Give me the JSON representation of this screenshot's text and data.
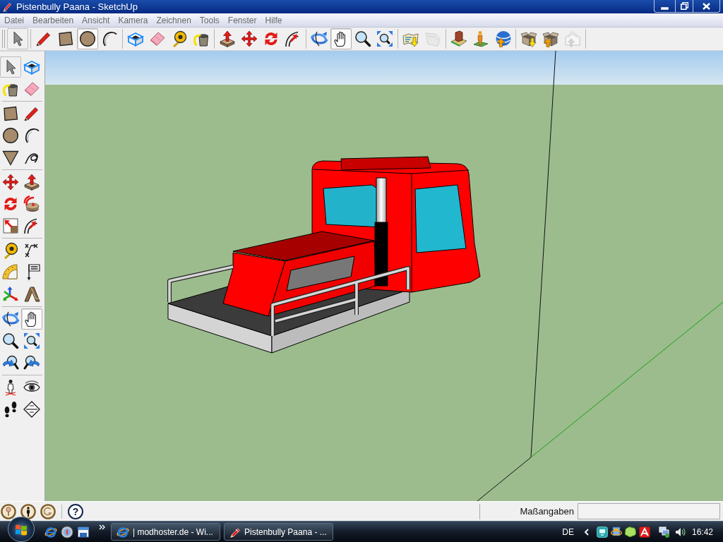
{
  "window": {
    "title": "Pistenbully Paana - SketchUp"
  },
  "menu_bar": [
    "Datei",
    "Bearbeiten",
    "Ansicht",
    "Kamera",
    "Zeichnen",
    "Tools",
    "Fenster",
    "Hilfe"
  ],
  "top_toolbar": {
    "groups": [
      [
        {
          "selected": false,
          "focused": true,
          "disabled": false
        }
      ],
      [
        {
          "selected": false,
          "focused": false,
          "disabled": false
        },
        {
          "selected": false,
          "focused": false,
          "disabled": false
        },
        {
          "selected": true,
          "focused": false,
          "disabled": false
        },
        {
          "selected": false,
          "focused": false,
          "disabled": false
        }
      ],
      [
        {
          "selected": false,
          "focused": false,
          "disabled": false
        },
        {
          "selected": false,
          "focused": false,
          "disabled": false
        },
        {
          "selected": false,
          "focused": false,
          "disabled": false
        },
        {
          "selected": false,
          "focused": false,
          "disabled": false
        }
      ],
      [
        {
          "selected": false,
          "focused": false,
          "disabled": false
        },
        {
          "selected": false,
          "focused": false,
          "disabled": false
        },
        {
          "selected": false,
          "focused": false,
          "disabled": false
        },
        {
          "selected": false,
          "focused": false,
          "disabled": false
        }
      ],
      [
        {
          "selected": false,
          "focused": false,
          "disabled": false
        },
        {
          "selected": true,
          "focused": false,
          "disabled": false
        },
        {
          "selected": false,
          "focused": false,
          "disabled": false
        },
        {
          "selected": false,
          "focused": false,
          "disabled": false
        }
      ],
      [
        {
          "selected": false,
          "focused": false,
          "disabled": false
        },
        {
          "selected": false,
          "focused": false,
          "disabled": true
        }
      ],
      [
        {
          "selected": false,
          "focused": false,
          "disabled": false
        },
        {
          "selected": false,
          "focused": false,
          "disabled": false
        },
        {
          "selected": false,
          "focused": false,
          "disabled": false
        }
      ],
      [
        {
          "selected": false,
          "focused": false,
          "disabled": false
        },
        {
          "selected": false,
          "focused": false,
          "disabled": false
        },
        {
          "selected": false,
          "focused": false,
          "disabled": true
        }
      ]
    ]
  },
  "side_toolbar": {
    "groups": [
      [
        {
          "selected": false,
          "focused": true
        },
        {
          "selected": false,
          "focused": false
        },
        {
          "selected": false,
          "focused": false
        },
        {
          "selected": false,
          "focused": false
        }
      ],
      [
        {
          "selected": false,
          "focused": false
        },
        {
          "selected": false,
          "focused": false
        },
        {
          "selected": false,
          "focused": false
        },
        {
          "selected": false,
          "focused": false
        },
        {
          "selected": false,
          "focused": false
        },
        {
          "selected": false,
          "focused": false
        }
      ],
      [
        {
          "selected": false,
          "focused": false
        },
        {
          "selected": false,
          "focused": false
        },
        {
          "selected": false,
          "focused": false
        },
        {
          "selected": false,
          "focused": false
        },
        {
          "selected": false,
          "focused": false
        },
        {
          "selected": false,
          "focused": false
        }
      ],
      [
        {
          "selected": false,
          "focused": false
        },
        {
          "selected": false,
          "focused": false
        },
        {
          "selected": false,
          "focused": false
        },
        {
          "selected": false,
          "focused": false
        },
        {
          "selected": false,
          "focused": false
        },
        {
          "selected": false,
          "focused": false
        }
      ],
      [
        {
          "selected": false,
          "focused": false
        },
        {
          "selected": true,
          "focused": false
        },
        {
          "selected": false,
          "focused": false
        },
        {
          "selected": false,
          "focused": false
        },
        {
          "selected": false,
          "focused": false
        },
        {
          "selected": false,
          "focused": false
        }
      ],
      [
        {
          "selected": false,
          "focused": false
        },
        {
          "selected": false,
          "focused": false
        },
        {
          "selected": false,
          "focused": false
        },
        {
          "selected": false,
          "focused": false
        }
      ]
    ]
  },
  "status_bar": {
    "help": "?",
    "measurements_label": "Maßangaben"
  },
  "taskbar": {
    "windows": [
      {
        "kind": "browser",
        "label": "| modhoster.de - Wi..."
      },
      {
        "kind": "modeler",
        "label": "Pistenbully Paana - ..."
      }
    ],
    "language": "DE",
    "clock": "16:42"
  }
}
